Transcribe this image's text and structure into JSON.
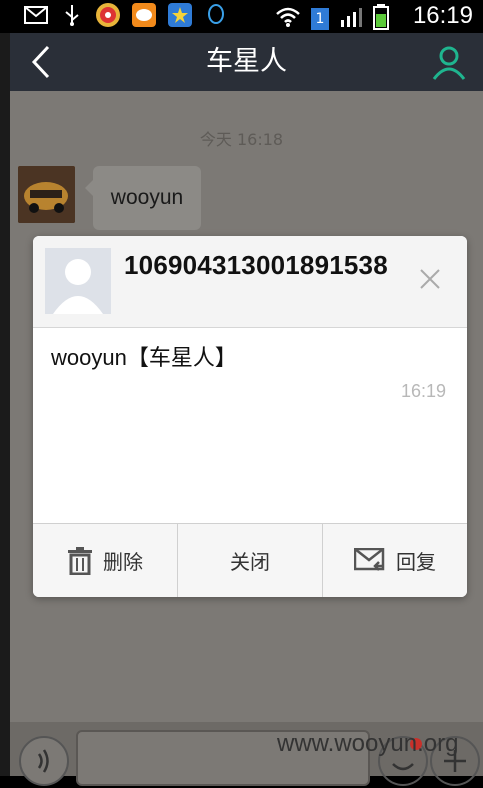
{
  "status_bar": {
    "time": "16:19",
    "sim_badge": "1",
    "icons": [
      "mail-icon",
      "usb-icon",
      "game-app-icon",
      "chat-app-icon",
      "star-app-icon",
      "qq-icon",
      "wifi-icon",
      "sim-icon",
      "signal-icon",
      "battery-icon"
    ]
  },
  "header": {
    "title": "车星人"
  },
  "chat": {
    "timestamp": "今天 16:18",
    "messages": [
      {
        "text": "wooyun"
      }
    ]
  },
  "dialog": {
    "sender": "106904313001891538",
    "message": "wooyun【车星人】",
    "time": "16:19",
    "actions": {
      "delete": "删除",
      "close": "关闭",
      "reply": "回复"
    }
  },
  "watermark": "www.wooyun.org",
  "colors": {
    "accent": "#1fb58f",
    "appbar": "#2a2f38"
  }
}
